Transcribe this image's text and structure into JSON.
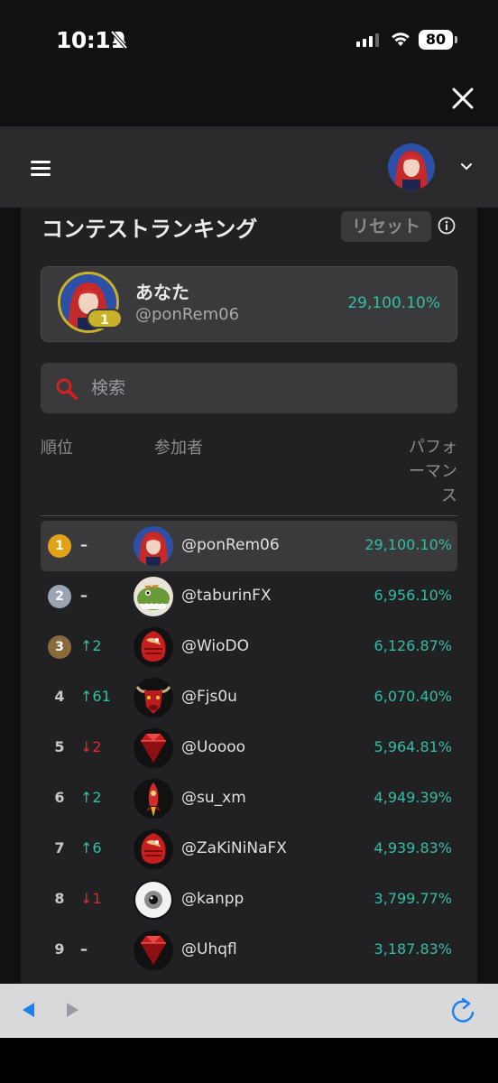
{
  "status": {
    "time": "10:11",
    "battery": "80"
  },
  "header": {
    "menu_icon": "hamburger-icon",
    "dropdown_icon": "chevron-down-icon"
  },
  "contest": {
    "title": "コンテストランキング",
    "reset_label": "リセット",
    "info_icon": "info-icon"
  },
  "me": {
    "name": "あなた",
    "handle": "@ponRem06",
    "rank": "1",
    "performance": "29,100.10%"
  },
  "search": {
    "placeholder": "検索"
  },
  "columns": {
    "rank": "順位",
    "participant": "参加者",
    "performance": "パフォーマンス"
  },
  "rows": [
    {
      "rank": "1",
      "medal": "gold",
      "change": "–",
      "dir": "none",
      "name": "@ponRem06",
      "perf": "29,100.10%",
      "avatar": "anime-girl"
    },
    {
      "rank": "2",
      "medal": "silver",
      "change": "–",
      "dir": "none",
      "name": "@taburinFX",
      "perf": "6,956.10%",
      "avatar": "dinosaur"
    },
    {
      "rank": "3",
      "medal": "bronze",
      "change": "↑2",
      "dir": "up",
      "name": "@WioDO",
      "perf": "6,126.87%",
      "avatar": "koi-fish"
    },
    {
      "rank": "4",
      "medal": "",
      "change": "↑61",
      "dir": "up",
      "name": "@Fjs0u",
      "perf": "6,070.40%",
      "avatar": "bull"
    },
    {
      "rank": "5",
      "medal": "",
      "change": "↓2",
      "dir": "down",
      "name": "@Uoooo",
      "perf": "5,964.81%",
      "avatar": "ruby"
    },
    {
      "rank": "6",
      "medal": "",
      "change": "↑2",
      "dir": "up",
      "name": "@su_xm",
      "perf": "4,949.39%",
      "avatar": "rocket"
    },
    {
      "rank": "7",
      "medal": "",
      "change": "↑6",
      "dir": "up",
      "name": "@ZaKiNiNaFX",
      "perf": "4,939.83%",
      "avatar": "koi-fish"
    },
    {
      "rank": "8",
      "medal": "",
      "change": "↓1",
      "dir": "down",
      "name": "@kanpp",
      "perf": "3,799.77%",
      "avatar": "eye"
    },
    {
      "rank": "9",
      "medal": "",
      "change": "–",
      "dir": "none",
      "name": "@Uhqfl",
      "perf": "3,187.83%",
      "avatar": "ruby"
    }
  ],
  "colors": {
    "positive": "#2fbfa4",
    "negative": "#e02a2a",
    "gold": "#e0a21a",
    "silver": "#9aa4b2",
    "bronze": "#8a6a3c"
  }
}
